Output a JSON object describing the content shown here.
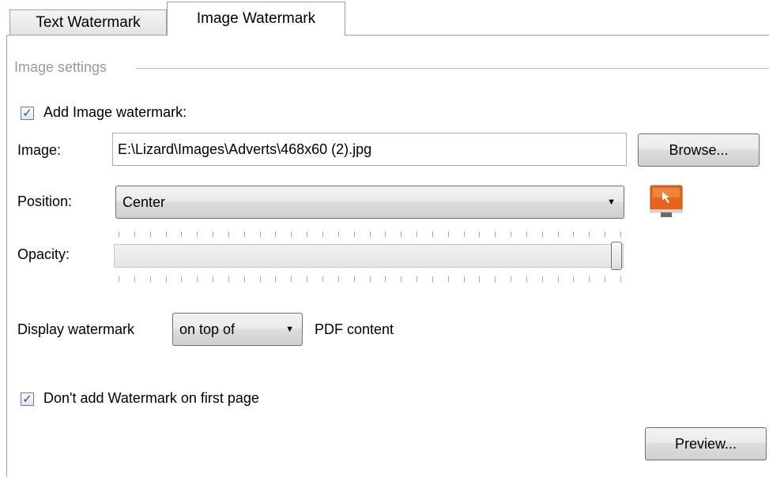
{
  "tabs": [
    {
      "label": "Text Watermark",
      "active": false
    },
    {
      "label": "Image Watermark",
      "active": true
    }
  ],
  "group": {
    "title": "Image settings"
  },
  "add_image": {
    "label": "Add Image watermark:",
    "checked": true
  },
  "image": {
    "label": "Image:",
    "value": "E:\\Lizard\\Images\\Adverts\\468x60 (2).jpg",
    "browse_label": "Browse..."
  },
  "position": {
    "label": "Position:",
    "selected": "Center",
    "icon": "monitor-arrow-icon"
  },
  "opacity": {
    "label": "Opacity:",
    "value_fraction": 1.0,
    "tick_count": 33
  },
  "display": {
    "prefix": "Display watermark",
    "selected": "on top of",
    "suffix": "PDF content"
  },
  "first_page": {
    "label": "Don't add Watermark on first page",
    "checked": true
  },
  "preview_label": "Preview...",
  "colors": {
    "accent_orange": "#e8641b",
    "checkmark": "#2b4d8e"
  }
}
